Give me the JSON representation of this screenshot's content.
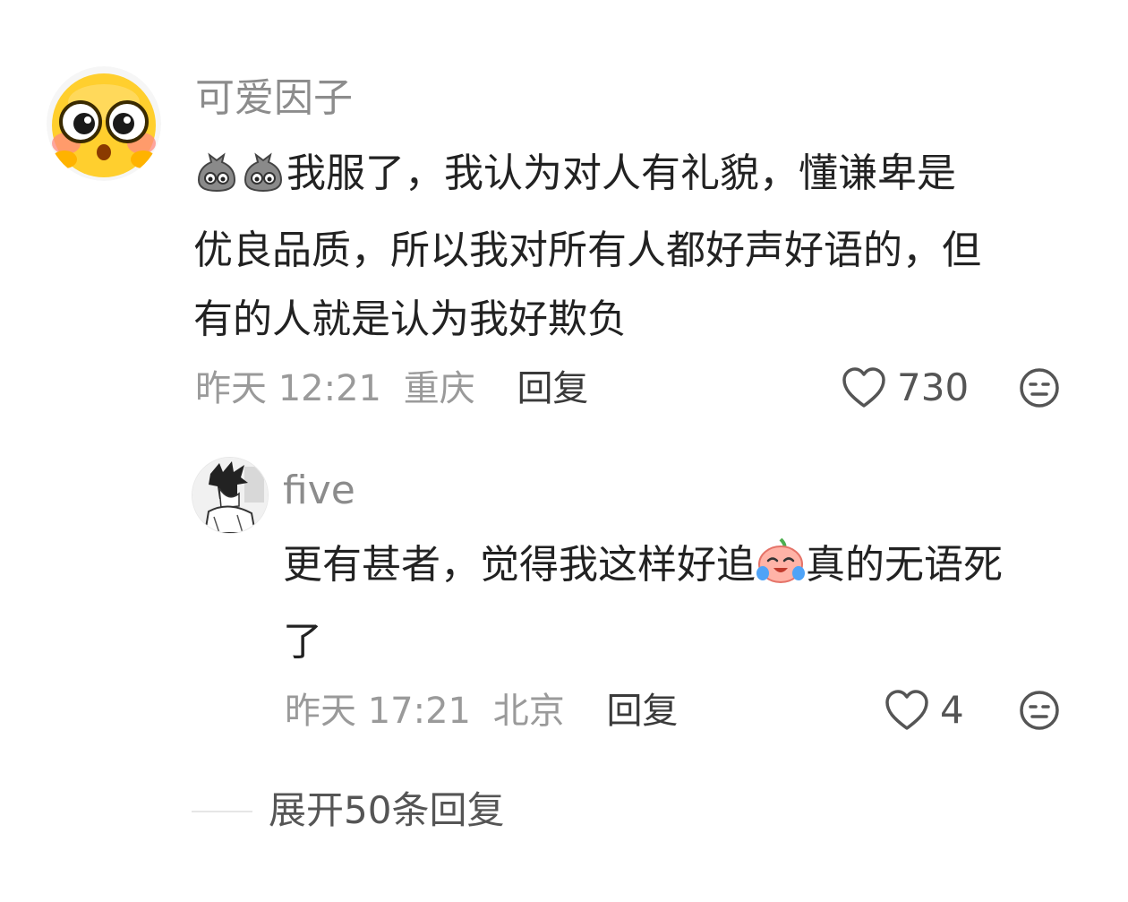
{
  "comment": {
    "username": "可爱因子",
    "text_lines": [
      "我服了，我认为对人有礼貌，懂谦卑是",
      "优良品质，所以我对所有人都好声好语的，但",
      "有的人就是认为我好欺负"
    ],
    "time": "昨天 12:21",
    "location": "重庆",
    "reply_label": "回复",
    "likes": "730",
    "avatar_icon": "yellow-emoji-face-icon",
    "leading_emoji_icon": "grey-sack-emoji-icon",
    "like_icon": "heart-outline-icon",
    "more_icon": "meh-face-icon"
  },
  "reply": {
    "username": "five",
    "text_before_emoji": "更有甚者，觉得我这样好追",
    "text_after_emoji": "真的无语死",
    "text_line2": "了",
    "inline_emoji_icon": "crying-laughing-peach-emoji-icon",
    "time": "昨天 17:21",
    "location": "北京",
    "reply_label": "回复",
    "likes": "4",
    "avatar_icon": "manga-character-avatar-icon"
  },
  "expand": {
    "label": "展开50条回复"
  },
  "colors": {
    "username": "#8c8c8c",
    "text": "#222222",
    "meta": "#9a9a9a",
    "reply": "#3a3a3a"
  }
}
